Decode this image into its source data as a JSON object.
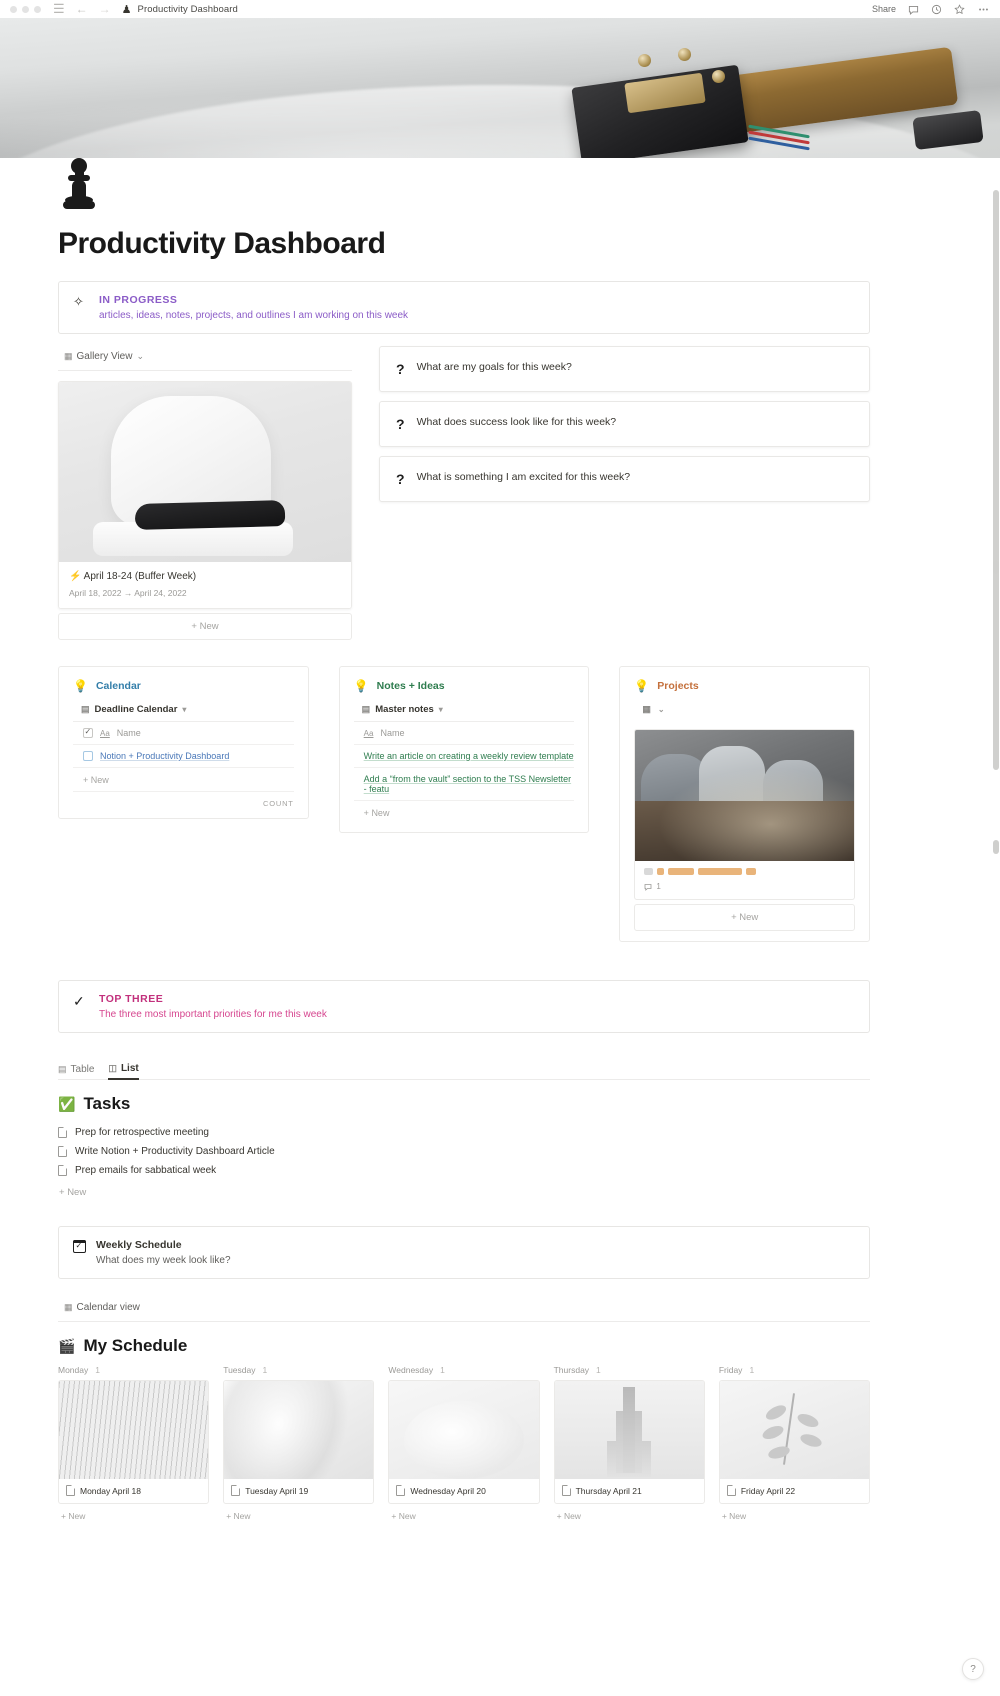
{
  "titlebar": {
    "page_title": "Productivity Dashboard",
    "page_icon": "chess-pawn-icon",
    "menu_icon": "hamburger-menu-icon",
    "back_icon": "back-arrow-icon",
    "forward_icon": "forward-arrow-icon",
    "share_label": "Share",
    "comment_icon": "comment-icon",
    "history_icon": "clock-history-icon",
    "favorite_icon": "star-icon",
    "more_icon": "more-options-icon"
  },
  "page": {
    "title": "Productivity Dashboard",
    "cover_image": "record-player-tonearm-cover"
  },
  "in_progress_callout": {
    "icon": "sparkler-icon",
    "title": "IN PROGRESS",
    "subtitle": "articles, ideas, notes, projects, and outlines I am working on this week",
    "color": "#8b5cc7"
  },
  "gallery_view": {
    "view_label": "Gallery View",
    "view_icon": "grid-view-icon",
    "chevron": "⌄",
    "card": {
      "title": "⚡ April 18-24 (Buffer Week)",
      "date_range": "April 18, 2022 → April 24, 2022"
    },
    "new_label": "New"
  },
  "questions": [
    {
      "icon": "?",
      "text": "What are my goals for this week?"
    },
    {
      "icon": "?",
      "text": "What does success look like for this week?"
    },
    {
      "icon": "?",
      "text": "What is something I am excited for this week?"
    }
  ],
  "columns": {
    "calendar": {
      "icon": "lightbulb-icon",
      "heading": "Calendar",
      "heading_color": "#337ea9",
      "source": "Deadline Calendar",
      "source_icon": "database-icon",
      "column_header": "Name",
      "column_header_icon": "Aa",
      "rows": [
        {
          "text": "Notion + Productivity Dashboard"
        }
      ],
      "new_label": "New",
      "count_label": "COUNT"
    },
    "notes": {
      "icon": "lightbulb-icon",
      "heading": "Notes + Ideas",
      "heading_color": "#2f7d4f",
      "source": "Master notes",
      "source_icon": "database-icon",
      "column_header": "Name",
      "column_header_icon": "Aa",
      "rows": [
        {
          "text": "Write an article on creating a weekly review template"
        },
        {
          "text": "Add a “from the vault” section to the TSS Newsletter - featu"
        }
      ],
      "new_label": "New"
    },
    "projects": {
      "icon": "lightbulb-icon",
      "heading": "Projects",
      "heading_color": "#c4703c",
      "source_icon": "grid-view-icon",
      "chevron": "⌄",
      "comment_count": "1",
      "new_label": "New"
    }
  },
  "top_three_callout": {
    "icon": "check-icon",
    "title": "TOP THREE",
    "subtitle": "The three most important priorities for me this week",
    "color": "#c2307c"
  },
  "tasks_section": {
    "tabs": [
      {
        "label": "Table",
        "icon": "table-view-icon",
        "active": false
      },
      {
        "label": "List",
        "icon": "list-view-icon",
        "active": true
      }
    ],
    "heading_icon": "✅",
    "heading": "Tasks",
    "items": [
      {
        "icon": "page-icon",
        "text": "Prep for retrospective meeting"
      },
      {
        "icon": "page-icon",
        "text": "Write Notion + Productivity Dashboard Article"
      },
      {
        "icon": "page-icon",
        "text": "Prep emails for sabbatical week"
      }
    ],
    "new_label": "New"
  },
  "weekly_schedule_callout": {
    "icon": "calendar-icon",
    "title": "Weekly Schedule",
    "subtitle": "What does my week look like?"
  },
  "schedule_view": {
    "view_label": "Calendar view",
    "view_icon": "grid-view-icon",
    "heading_icon": "🎬",
    "heading": "My Schedule",
    "new_label": "New",
    "days": [
      {
        "label": "Monday",
        "count": "1",
        "card_title": "Monday April 18",
        "image": "vertical-lines-image"
      },
      {
        "label": "Tuesday",
        "count": "1",
        "card_title": "Tuesday April 19",
        "image": "abstract-wave-image"
      },
      {
        "label": "Wednesday",
        "count": "1",
        "card_title": "Wednesday April 20",
        "image": "soft-light-image"
      },
      {
        "label": "Thursday",
        "count": "1",
        "card_title": "Thursday April 21",
        "image": "tower-image"
      },
      {
        "label": "Friday",
        "count": "1",
        "card_title": "Friday April 22",
        "image": "leaf-branch-image"
      }
    ]
  },
  "help_button": {
    "label": "?"
  }
}
